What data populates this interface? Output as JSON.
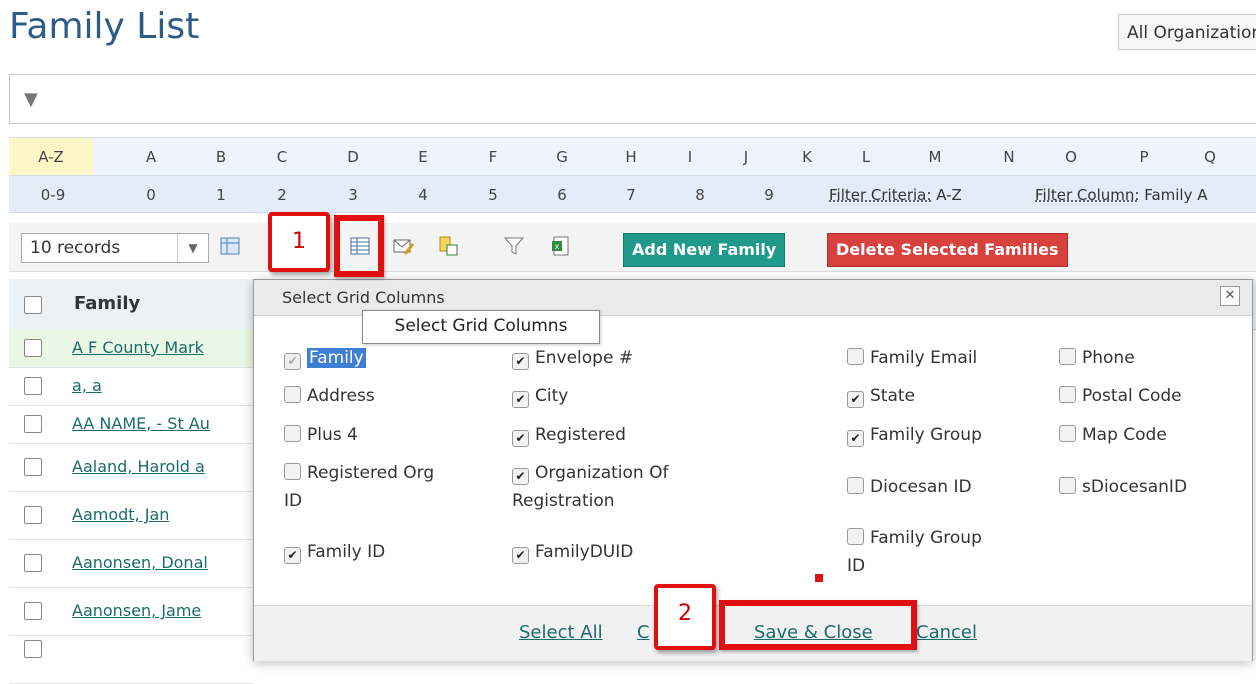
{
  "page": {
    "title": "Family List",
    "org_select": "All Organizations"
  },
  "alpha": {
    "row1": [
      "A-Z",
      "A",
      "B",
      "C",
      "D",
      "E",
      "F",
      "G",
      "H",
      "I",
      "J",
      "K",
      "L",
      "M",
      "N",
      "O",
      "P",
      "Q"
    ],
    "row2": [
      "0-9",
      "0",
      "1",
      "2",
      "3",
      "4",
      "5",
      "6",
      "7",
      "8",
      "9"
    ],
    "filter_criteria_label": "Filter Criteria:",
    "filter_criteria_value": "A-Z",
    "filter_column_label": "Filter Column:",
    "filter_column_value": "Family A"
  },
  "toolbar": {
    "records": "10 records",
    "add_label": "Add New Family",
    "delete_label": "Delete Selected Families",
    "icons": [
      "grid-view-icon",
      "select-columns-icon",
      "email-icon",
      "export-icon",
      "filter-icon",
      "excel-icon"
    ]
  },
  "grid": {
    "header": "Family",
    "rows": [
      "A F County Mark",
      "a, a",
      "AA NAME, - St Au",
      "Aaland, Harold a",
      "Aamodt, Jan",
      "Aanonsen, Donal",
      "Aanonsen, Jame"
    ]
  },
  "tooltip": "Select Grid Columns",
  "dialog": {
    "title": "Select Grid Columns",
    "columns": [
      {
        "label": "Family",
        "checked": true,
        "disabled": true
      },
      {
        "label": "Envelope #",
        "checked": true
      },
      {
        "label": "Family Email",
        "checked": false
      },
      {
        "label": "Phone",
        "checked": false
      },
      {
        "label": "Address",
        "checked": false
      },
      {
        "label": "City",
        "checked": true
      },
      {
        "label": "State",
        "checked": true
      },
      {
        "label": "Postal Code",
        "checked": false
      },
      {
        "label": "Plus 4",
        "checked": false
      },
      {
        "label": "Registered",
        "checked": true
      },
      {
        "label": "Family Group",
        "checked": true
      },
      {
        "label": "Map Code",
        "checked": false
      },
      {
        "label": "Registered Org",
        "label2": "ID",
        "checked": false
      },
      {
        "label": "Organization Of",
        "label2": "Registration",
        "checked": true
      },
      {
        "label": "Diocesan ID",
        "checked": false
      },
      {
        "label": "sDiocesanID",
        "checked": false
      },
      {
        "label": "Family ID",
        "checked": true
      },
      {
        "label": "FamilyDUID",
        "checked": true
      },
      {
        "label": "Family Group",
        "label2": "ID",
        "checked": false
      }
    ],
    "select_all": "Select All",
    "clear": "C",
    "save_close": "Save & Close",
    "cancel": "Cancel"
  },
  "callouts": {
    "one": "1",
    "two": "2"
  },
  "colors": {
    "accent_red": "#e01010",
    "add_btn": "#1f9a8a",
    "delete_btn": "#d9413f",
    "link": "#1c6b6b",
    "title": "#2d5c88"
  }
}
